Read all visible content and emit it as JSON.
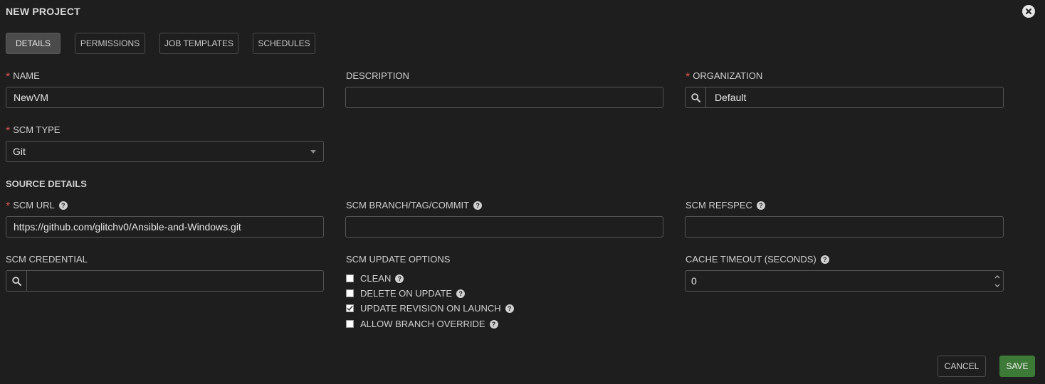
{
  "header": {
    "title": "NEW PROJECT"
  },
  "tabs": [
    {
      "label": "DETAILS",
      "active": true
    },
    {
      "label": "PERMISSIONS",
      "active": false
    },
    {
      "label": "JOB TEMPLATES",
      "active": false
    },
    {
      "label": "SCHEDULES",
      "active": false
    }
  ],
  "form": {
    "name": {
      "label": "NAME",
      "value": "NewVM"
    },
    "description": {
      "label": "DESCRIPTION",
      "value": ""
    },
    "organization": {
      "label": "ORGANIZATION",
      "value": "Default"
    },
    "scm_type": {
      "label": "SCM TYPE",
      "value": "Git"
    },
    "source_details": {
      "title": "SOURCE DETAILS"
    },
    "scm_url": {
      "label": "SCM URL",
      "value": "https://github.com/glitchv0/Ansible-and-Windows.git"
    },
    "scm_branch": {
      "label": "SCM BRANCH/TAG/COMMIT",
      "value": ""
    },
    "scm_refspec": {
      "label": "SCM REFSPEC",
      "value": ""
    },
    "scm_credential": {
      "label": "SCM CREDENTIAL",
      "value": ""
    },
    "scm_update_options": {
      "label": "SCM UPDATE OPTIONS",
      "options": [
        {
          "label": "CLEAN",
          "checked": false
        },
        {
          "label": "DELETE ON UPDATE",
          "checked": false
        },
        {
          "label": "UPDATE REVISION ON LAUNCH",
          "checked": true
        },
        {
          "label": "ALLOW BRANCH OVERRIDE",
          "checked": false
        }
      ]
    },
    "cache_timeout": {
      "label": "CACHE TIMEOUT (SECONDS)",
      "value": "0"
    }
  },
  "actions": {
    "cancel_label": "CANCEL",
    "save_label": "SAVE"
  },
  "icons": {
    "close": "close-circle-icon",
    "help": "question-circle-icon",
    "search": "search-icon"
  },
  "colors": {
    "background": "#1e1e1e",
    "required": "#d9534f",
    "save": "#3d7a37"
  }
}
